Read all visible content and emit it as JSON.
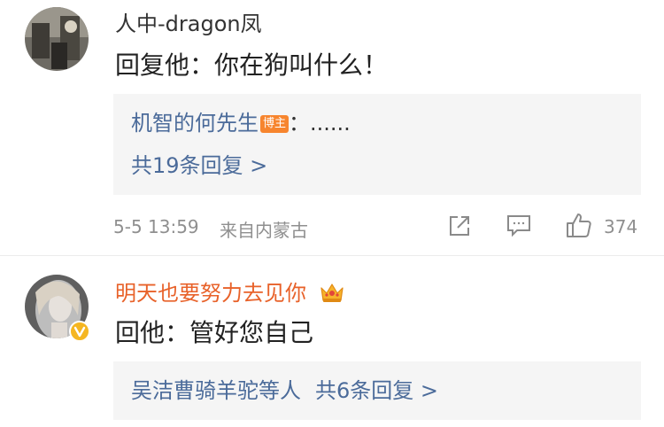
{
  "comments": [
    {
      "author": "人中-dragon凤",
      "text": "回复他：你在狗叫什么！",
      "replies": {
        "preview_author": "机智的何先生",
        "preview_badge": "博主",
        "preview_text": "：......",
        "count_label": "共19条回复 >"
      },
      "meta": {
        "timestamp": "5-5 13:59",
        "location": "来自内蒙古",
        "like_count": "374"
      }
    },
    {
      "author": "明天也要努力去见你",
      "text": "回他：管好您自己",
      "replies": {
        "preview_author": "吴洁曹骑羊驼等人",
        "count_label": "共6条回复 >"
      }
    }
  ],
  "colors": {
    "link": "#4b6b9a",
    "username_orange": "#e8622a",
    "badge_orange": "#f7852e",
    "verified_gold": "#f5b621"
  }
}
